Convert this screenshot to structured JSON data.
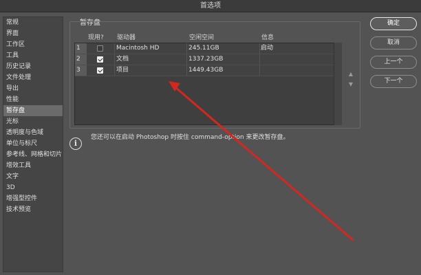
{
  "window": {
    "title": "首选项"
  },
  "sidebar": {
    "items": [
      {
        "label": "常规"
      },
      {
        "label": "界面"
      },
      {
        "label": "工作区"
      },
      {
        "label": "工具"
      },
      {
        "label": "历史记录"
      },
      {
        "label": "文件处理"
      },
      {
        "label": "导出"
      },
      {
        "label": "性能"
      },
      {
        "label": "暂存盘",
        "selected": true
      },
      {
        "label": "光标"
      },
      {
        "label": "透明度与色域"
      },
      {
        "label": "单位与标尺"
      },
      {
        "label": "参考线、网格和切片"
      },
      {
        "label": "增效工具"
      },
      {
        "label": "文字"
      },
      {
        "label": "3D"
      },
      {
        "label": "增强型控件"
      },
      {
        "label": "技术预览"
      }
    ]
  },
  "scratch": {
    "section_title": "暂存盘",
    "columns": {
      "active": "现用?",
      "drive": "驱动器",
      "free_space": "空闲空间",
      "info": "信息"
    },
    "rows": [
      {
        "num": "1",
        "checked": false,
        "drive": "Macintosh HD",
        "free": "245.11GB",
        "info": "启动"
      },
      {
        "num": "2",
        "checked": true,
        "drive": "文档",
        "free": "1337.23GB",
        "info": ""
      },
      {
        "num": "3",
        "checked": true,
        "drive": "项目",
        "free": "1449.43GB",
        "info": ""
      }
    ],
    "info_text": "您还可以在启动 Photoshop 时按住 command-option 来更改暂存盘。"
  },
  "buttons": {
    "ok": "确定",
    "cancel": "取消",
    "prev": "上一个",
    "next": "下一个"
  },
  "icons": {
    "info": "info-icon",
    "move_up": "triangle-up-icon",
    "move_down": "triangle-down-icon"
  },
  "colors": {
    "annotation_arrow": "#d4271f",
    "background": "#535353"
  }
}
